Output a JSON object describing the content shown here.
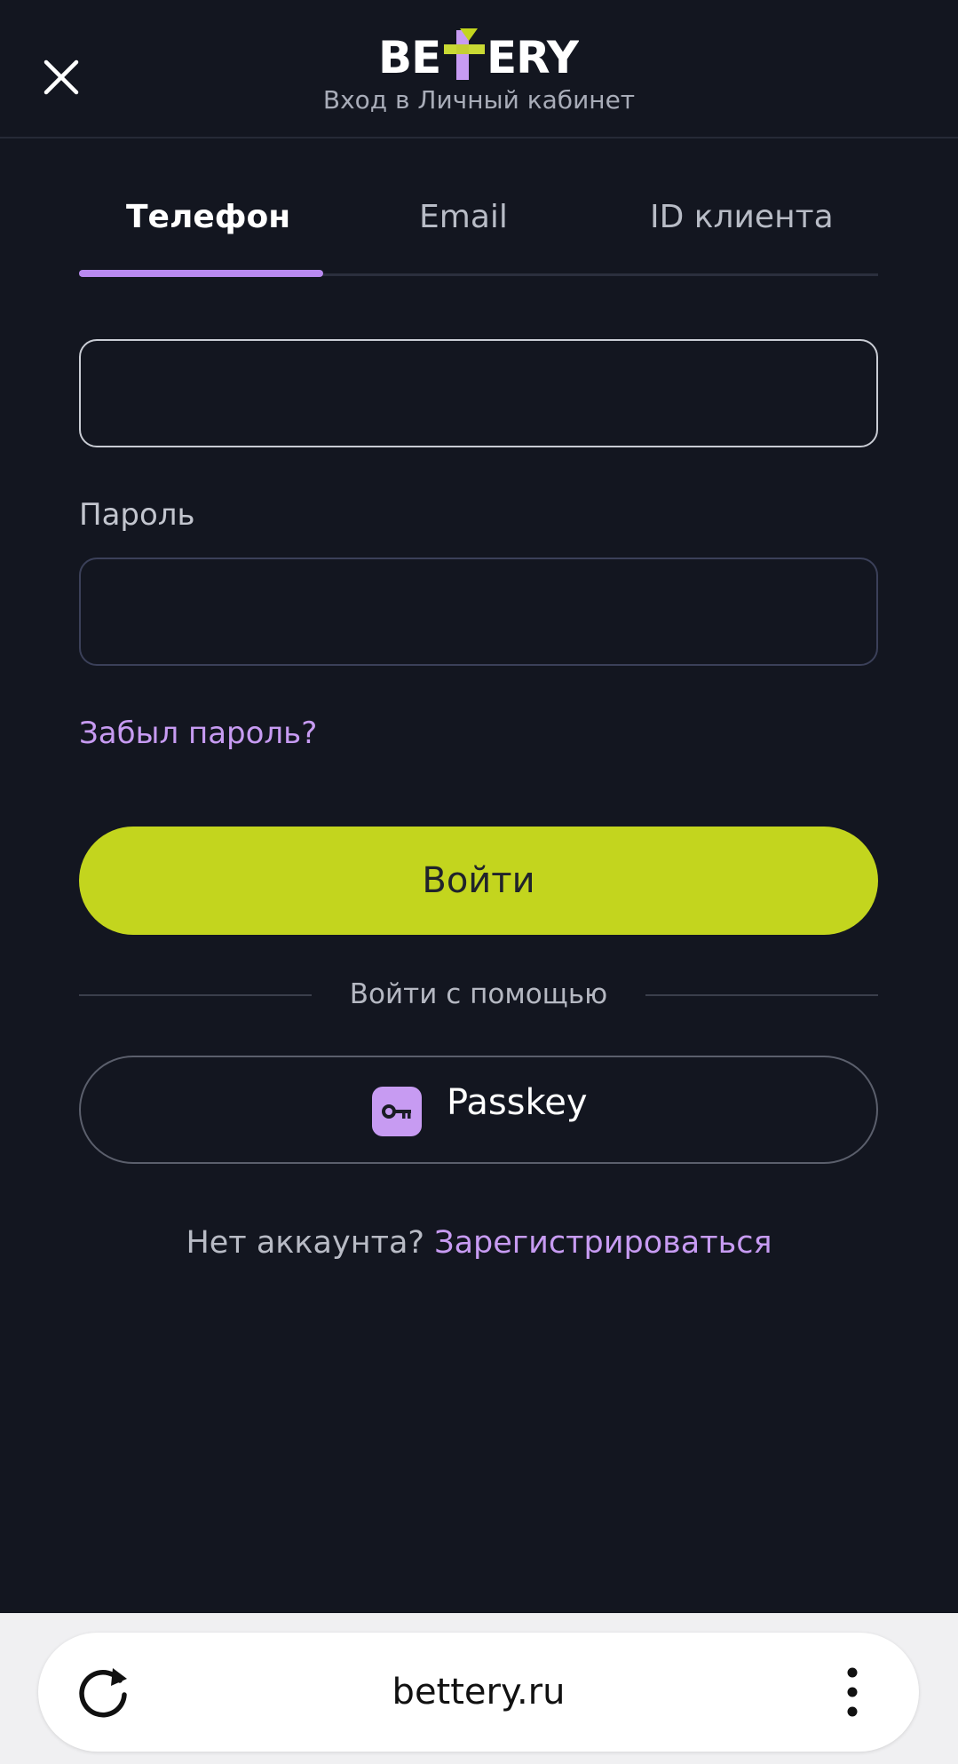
{
  "header": {
    "logo_text": "BETTERY",
    "subtitle": "Вход в Личный кабинет"
  },
  "tabs": [
    {
      "label": "Телефон",
      "active": true
    },
    {
      "label": "Email",
      "active": false
    },
    {
      "label": "ID клиента",
      "active": false
    }
  ],
  "form": {
    "phone_value": "",
    "password_label": "Пароль",
    "password_value": "",
    "forgot_link": "Забыл пароль?",
    "login_button": "Войти",
    "divider_text": "Войти с помощью",
    "passkey_button": "Passkey",
    "no_account_text": "Нет аккаунта?",
    "register_link": "Зарегистрироваться"
  },
  "browser": {
    "url": "bettery.ru"
  },
  "colors": {
    "background": "#131620",
    "accent_purple": "#c79bf2",
    "login_button": "#c3d51e",
    "logo_lime": "#c3d51e"
  },
  "icons": {
    "close": "close-icon",
    "passkey": "key-icon",
    "reload": "reload-icon",
    "menu": "more-vertical-icon"
  }
}
